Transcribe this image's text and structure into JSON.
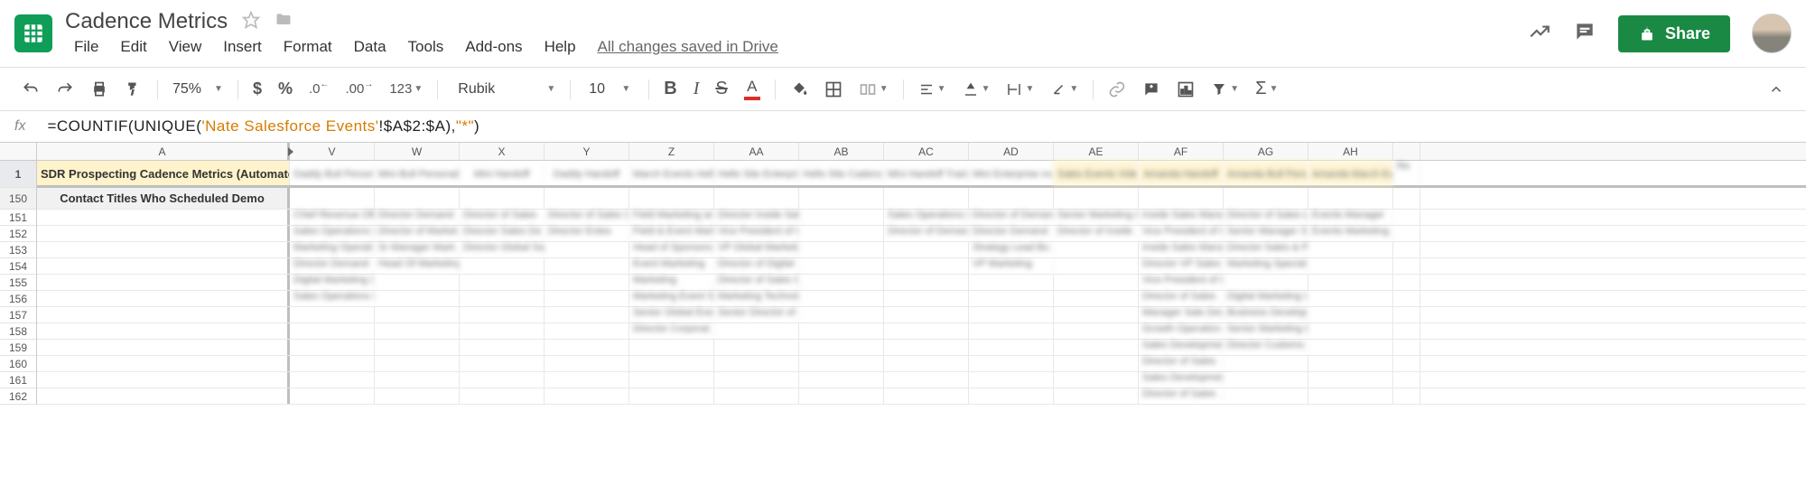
{
  "header": {
    "doc_title": "Cadence Metrics",
    "menu": [
      "File",
      "Edit",
      "View",
      "Insert",
      "Format",
      "Data",
      "Tools",
      "Add-ons",
      "Help"
    ],
    "save_status": "All changes saved in Drive",
    "share_label": "Share"
  },
  "toolbar": {
    "zoom": "75%",
    "format_123": "123",
    "font": "Rubik",
    "font_size": "10"
  },
  "formula": {
    "prefix": "=COUNTIF(UNIQUE(",
    "sheet_ref": "'Nate Salesforce Events'",
    "range": "!$A$2:$A",
    "suffix1": "),",
    "wildcard": "\"*\"",
    "suffix2": ")"
  },
  "sheet": {
    "selected_row": "1",
    "row_nums": [
      "150",
      "151",
      "152",
      "153",
      "154",
      "155",
      "156",
      "157",
      "158",
      "159",
      "160",
      "161",
      "162"
    ],
    "col_letters": [
      "A",
      "V",
      "W",
      "X",
      "Y",
      "Z",
      "AA",
      "AB",
      "AC",
      "AD",
      "AE",
      "AF",
      "AG",
      "AH"
    ],
    "frozen_title": "SDR Prospecting Cadence Metrics (Automated)",
    "subheader": "Contact Titles Who Scheduled Demo",
    "highlight_cols": [
      "AE",
      "AF",
      "AG",
      "AH"
    ]
  }
}
